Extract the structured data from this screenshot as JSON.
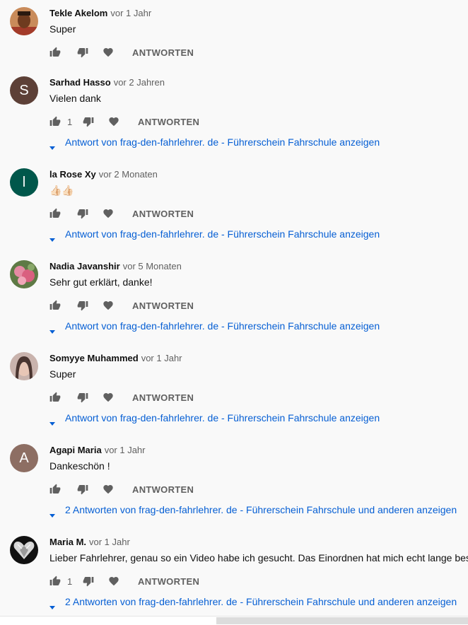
{
  "comments": [
    {
      "author": "Tekle Akelom",
      "date": "vor 1 Jahr",
      "text": "Super",
      "likes": "",
      "reply_label": "ANTWORTEN",
      "replies": "",
      "avatar_letter": "",
      "avatar_color": "#8a5a3c"
    },
    {
      "author": "Sarhad Hasso",
      "date": "vor 2 Jahren",
      "text": "Vielen dank",
      "likes": "1",
      "reply_label": "ANTWORTEN",
      "replies": "Antwort von frag-den-fahrlehrer. de - Führerschein Fahrschule anzeigen",
      "avatar_letter": "S",
      "avatar_color": "#5d4037"
    },
    {
      "author": "la Rose Xy",
      "date": "vor 2 Monaten",
      "text": "👍🏻👍🏻",
      "likes": "",
      "reply_label": "ANTWORTEN",
      "replies": "Antwort von frag-den-fahrlehrer. de - Führerschein Fahrschule anzeigen",
      "avatar_letter": "l",
      "avatar_color": "#00574b"
    },
    {
      "author": "Nadia Javanshir",
      "date": "vor 5 Monaten",
      "text": "Sehr gut erklärt, danke!",
      "likes": "",
      "reply_label": "ANTWORTEN",
      "replies": "Antwort von frag-den-fahrlehrer. de - Führerschein Fahrschule anzeigen",
      "avatar_letter": "",
      "avatar_color": "#6b7a4e"
    },
    {
      "author": "Somyye Muhammed",
      "date": "vor 1 Jahr",
      "text": "Super",
      "likes": "",
      "reply_label": "ANTWORTEN",
      "replies": "Antwort von frag-den-fahrlehrer. de - Führerschein Fahrschule anzeigen",
      "avatar_letter": "",
      "avatar_color": "#b7a2a0"
    },
    {
      "author": "Agapi Maria",
      "date": "vor 1 Jahr",
      "text": "Dankeschön !",
      "likes": "",
      "reply_label": "ANTWORTEN",
      "replies": "2 Antworten von frag-den-fahrlehrer. de - Führerschein Fahrschule und anderen anzeigen",
      "avatar_letter": "A",
      "avatar_color": "#8d6e63"
    },
    {
      "author": "Maria M.",
      "date": "vor 1 Jahr",
      "text": "Lieber Fahrlehrer, genau so ein Video habe ich gesucht. Das Einordnen hat mich echt lange besc",
      "likes": "1",
      "reply_label": "ANTWORTEN",
      "replies": "2 Antworten von frag-den-fahrlehrer. de - Führerschein Fahrschule und anderen anzeigen",
      "avatar_letter": "",
      "avatar_color": "#1a1a1a"
    }
  ],
  "colors": {
    "link": "#065fd4",
    "secondary": "#606060",
    "background": "#f9f9f9"
  },
  "icons": {
    "like": "thumb-up-icon",
    "dislike": "thumb-down-icon",
    "heart": "heart-icon",
    "expand": "caret-down-icon"
  }
}
